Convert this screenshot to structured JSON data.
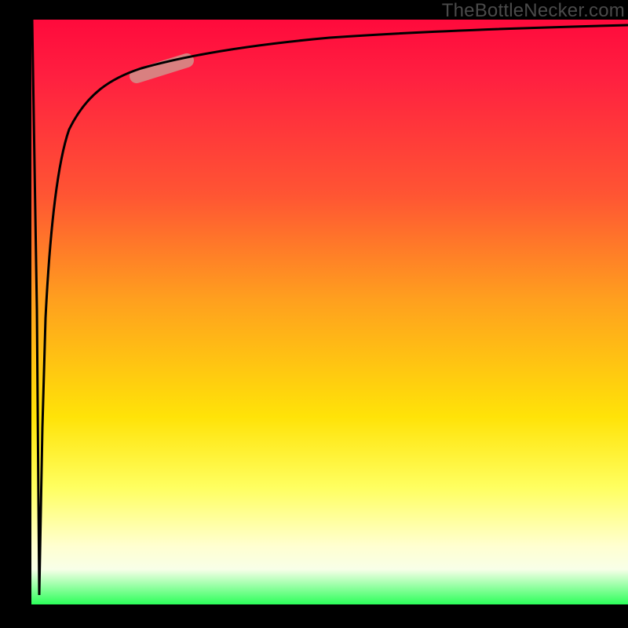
{
  "watermark": "TheBottleNecker.com",
  "colors": {
    "frame": "#000000",
    "curve_stroke": "#000000",
    "marker_fill": "#d98080",
    "gradient_stops": [
      "#ff0a3c",
      "#ff5533",
      "#ffa01e",
      "#ffe308",
      "#ffff60",
      "#ffffd0",
      "#2cff5a"
    ]
  },
  "chart_data": {
    "type": "line",
    "title": "",
    "xlabel": "",
    "ylabel": "",
    "xlim": [
      0,
      100
    ],
    "ylim": [
      0,
      100
    ],
    "series": [
      {
        "name": "curve",
        "comment": "Sharp spike down at x≈0 then asymptotic rise toward y≈100. Values estimated from pixel positions; y read against gradient (top=100, bottom=0).",
        "x": [
          0,
          0.5,
          1,
          1.5,
          2,
          3,
          4,
          5,
          7,
          10,
          15,
          20,
          25,
          30,
          40,
          50,
          60,
          70,
          80,
          90,
          100
        ],
        "y": [
          100,
          50,
          2,
          30,
          50,
          65,
          73,
          78,
          83,
          87,
          90,
          91.5,
          92.5,
          93.3,
          94.5,
          95.4,
          96.1,
          96.7,
          97.2,
          97.6,
          98
        ]
      }
    ],
    "marker": {
      "comment": "Salmon capsule highlighting a short segment of the curve near its knee.",
      "x_range": [
        18,
        26
      ],
      "y_range": [
        90.8,
        92.8
      ]
    }
  }
}
